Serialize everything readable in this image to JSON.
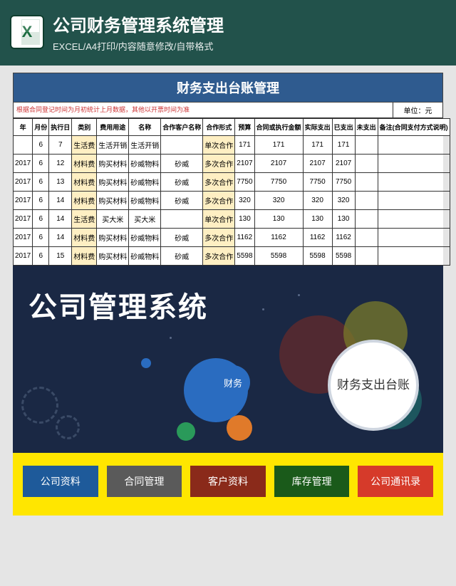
{
  "header": {
    "title": "公司财务管理系统管理",
    "subtitle": "EXCEL/A4打印/内容随意修改/自带格式",
    "icon_label": "X"
  },
  "sheet": {
    "title": "财务支出台账管理",
    "note": "根据合同登记时间为月初统计上月数据，其他以开票时间为准",
    "unit": "单位：元",
    "headers": [
      "年",
      "月份",
      "执行日",
      "类别",
      "费用用途",
      "名称",
      "合作客户名称",
      "合作形式",
      "预算",
      "合同或执行金额",
      "实际支出",
      "已支出",
      "未支出",
      "备注(合同支付方式说明)"
    ],
    "rows": [
      {
        "year": "",
        "mon": "6",
        "day": "7",
        "cat": "生活费",
        "use": "生活开销",
        "name": "生活开销",
        "cust": "",
        "form": "单次合作",
        "v1": "171",
        "v2": "171",
        "v3": "171",
        "v4": "171",
        "v5": "",
        "note": ""
      },
      {
        "year": "2017",
        "mon": "6",
        "day": "12",
        "cat": "材料费",
        "use": "购买材料",
        "name": "砂威物料",
        "cust": "砂威",
        "form": "多次合作",
        "v1": "2107",
        "v2": "2107",
        "v3": "2107",
        "v4": "2107",
        "v5": "",
        "note": ""
      },
      {
        "year": "2017",
        "mon": "6",
        "day": "13",
        "cat": "材料费",
        "use": "购买材料",
        "name": "砂威物料",
        "cust": "砂威",
        "form": "多次合作",
        "v1": "7750",
        "v2": "7750",
        "v3": "7750",
        "v4": "7750",
        "v5": "",
        "note": ""
      },
      {
        "year": "2017",
        "mon": "6",
        "day": "14",
        "cat": "材料费",
        "use": "购买材料",
        "name": "砂威物料",
        "cust": "砂威",
        "form": "多次合作",
        "v1": "320",
        "v2": "320",
        "v3": "320",
        "v4": "320",
        "v5": "",
        "note": ""
      },
      {
        "year": "2017",
        "mon": "6",
        "day": "14",
        "cat": "生活费",
        "use": "买大米",
        "name": "买大米",
        "cust": "",
        "form": "单次合作",
        "v1": "130",
        "v2": "130",
        "v3": "130",
        "v4": "130",
        "v5": "",
        "note": ""
      },
      {
        "year": "2017",
        "mon": "6",
        "day": "14",
        "cat": "材料费",
        "use": "购买材料",
        "name": "砂威物料",
        "cust": "砂威",
        "form": "多次合作",
        "v1": "1162",
        "v2": "1162",
        "v3": "1162",
        "v4": "1162",
        "v5": "",
        "note": ""
      },
      {
        "year": "2017",
        "mon": "6",
        "day": "15",
        "cat": "材料费",
        "use": "购买材料",
        "name": "砂威物料",
        "cust": "砂威",
        "form": "多次合作",
        "v1": "5598",
        "v2": "5598",
        "v3": "5598",
        "v4": "5598",
        "v5": "",
        "note": ""
      }
    ]
  },
  "dash": {
    "title": "公司管理系统",
    "fin": "财务",
    "disc": "财务支出台账",
    "buttons": [
      "公司资料",
      "合同管理",
      "客户资料",
      "库存管理",
      "公司通讯录"
    ]
  },
  "chart_data": {
    "type": "table",
    "title": "财务支出台账管理",
    "columns": [
      "年",
      "月份",
      "执行日",
      "类别",
      "费用用途",
      "名称",
      "合作客户名称",
      "合作形式",
      "预算",
      "合同或执行金额",
      "实际支出",
      "已支出"
    ],
    "rows": [
      [
        "",
        6,
        7,
        "生活费",
        "生活开销",
        "生活开销",
        "",
        "单次合作",
        171,
        171,
        171,
        171
      ],
      [
        2017,
        6,
        12,
        "材料费",
        "购买材料",
        "砂威物料",
        "砂威",
        "多次合作",
        2107,
        2107,
        2107,
        2107
      ],
      [
        2017,
        6,
        13,
        "材料费",
        "购买材料",
        "砂威物料",
        "砂威",
        "多次合作",
        7750,
        7750,
        7750,
        7750
      ],
      [
        2017,
        6,
        14,
        "材料费",
        "购买材料",
        "砂威物料",
        "砂威",
        "多次合作",
        320,
        320,
        320,
        320
      ],
      [
        2017,
        6,
        14,
        "生活费",
        "买大米",
        "买大米",
        "",
        "单次合作",
        130,
        130,
        130,
        130
      ],
      [
        2017,
        6,
        14,
        "材料费",
        "购买材料",
        "砂威物料",
        "砂威",
        "多次合作",
        1162,
        1162,
        1162,
        1162
      ],
      [
        2017,
        6,
        15,
        "材料费",
        "购买材料",
        "砂威物料",
        "砂威",
        "多次合作",
        5598,
        5598,
        5598,
        5598
      ]
    ]
  }
}
